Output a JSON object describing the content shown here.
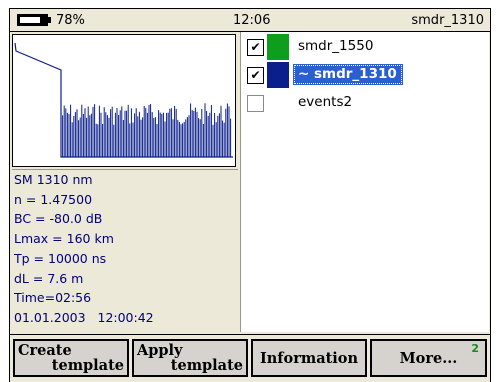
{
  "status": {
    "battery_level": 0.78,
    "battery_percent": "78%",
    "time": "12:06",
    "active_trace": "smdr_1310"
  },
  "parameters": [
    "SM 1310 nm",
    "n = 1.47500",
    "BC = -80.0 dB",
    "Lmax = 160 km",
    "Tp = 10000 ns",
    "dL = 7.6 m",
    "Time=02:56",
    "01.01.2003   12:00:42"
  ],
  "traces": [
    {
      "name": "smdr_1550",
      "checked": true,
      "checkmark": "✔",
      "color": "#0e9e1e",
      "selected": false
    },
    {
      "name": "~ smdr_1310",
      "checked": true,
      "checkmark": "✔",
      "color": "#0a1e8c",
      "selected": true
    },
    {
      "name": "events2",
      "checked": false,
      "checkmark": "",
      "color": "",
      "selected": false
    }
  ],
  "buttons": {
    "create": {
      "line1": "Create",
      "line2": "template"
    },
    "apply": {
      "line1": "Apply",
      "line2": "template"
    },
    "information": {
      "label": "Information"
    },
    "more": {
      "label": "More...",
      "badge": "2"
    }
  },
  "colors": {
    "trace_blue": "#0a1e8c",
    "selection": "#2a5fd0",
    "param_text": "#00007a",
    "badge_green": "#1c8a1c"
  }
}
